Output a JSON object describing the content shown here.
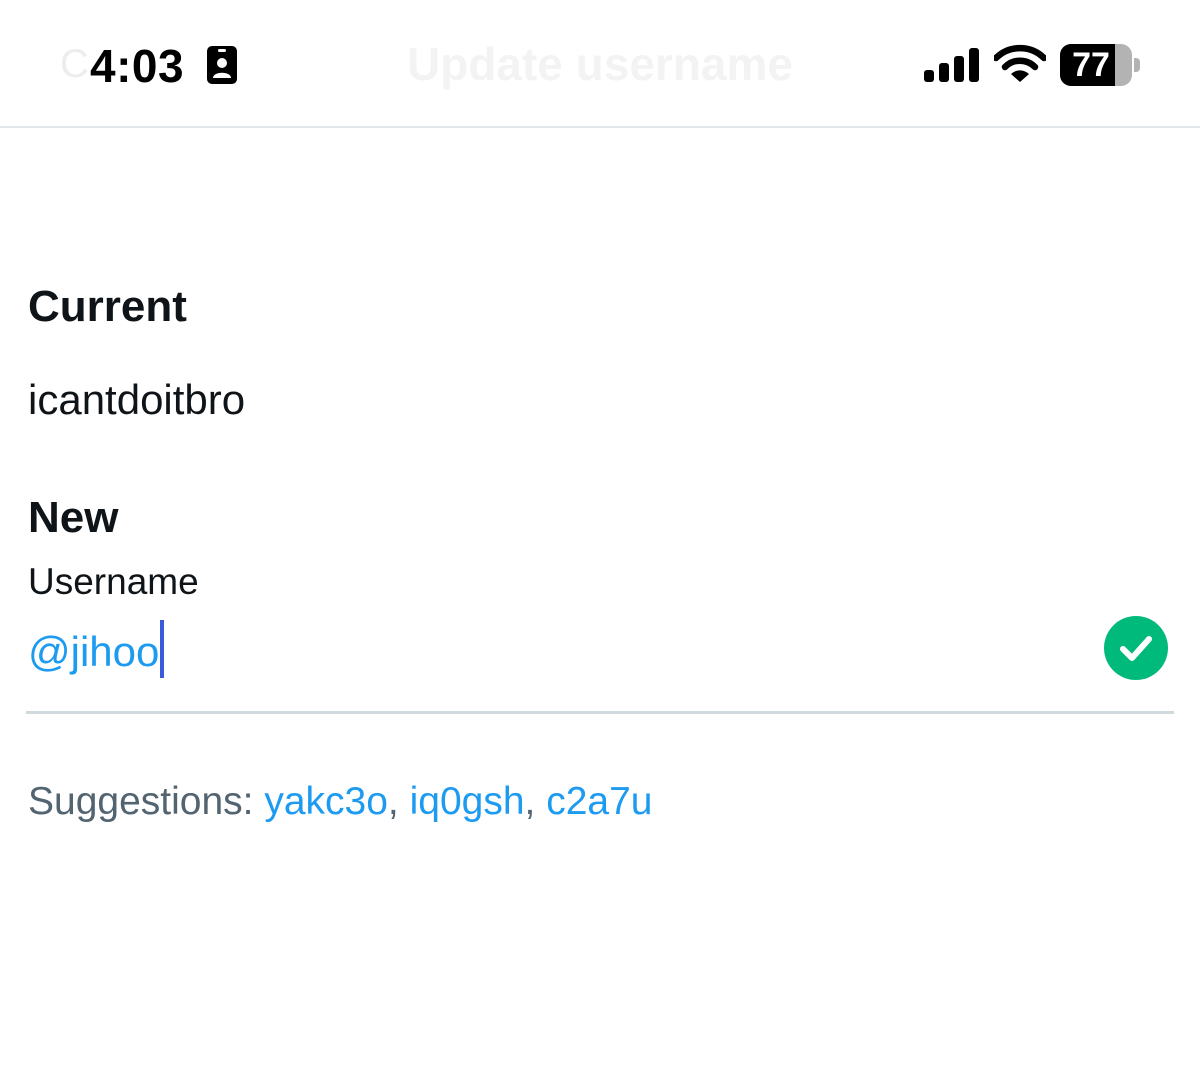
{
  "status_bar": {
    "time": "4:03",
    "battery_level": "77",
    "battery_fraction": 0.77
  },
  "header": {
    "cancel_label": "C",
    "title": "Update username"
  },
  "current": {
    "heading": "Current",
    "username": "icantdoitbro"
  },
  "new": {
    "heading": "New",
    "field_label": "Username",
    "value": "@jihoo",
    "valid": true
  },
  "suggestions": {
    "prefix": "Suggestions:",
    "separator": ",",
    "items": [
      "yakc3o",
      "iq0gsh",
      "c2a7u"
    ]
  },
  "colors": {
    "accent": "#1d9bf0",
    "success": "#00ba7c",
    "caret": "#3a5bd9",
    "muted": "#536471",
    "divider": "#cfd9de"
  },
  "icons": {
    "status_left": "id-card-icon",
    "signal": "cellular-signal-icon",
    "wifi": "wifi-icon",
    "battery": "battery-icon",
    "validation": "check-circle-icon"
  }
}
